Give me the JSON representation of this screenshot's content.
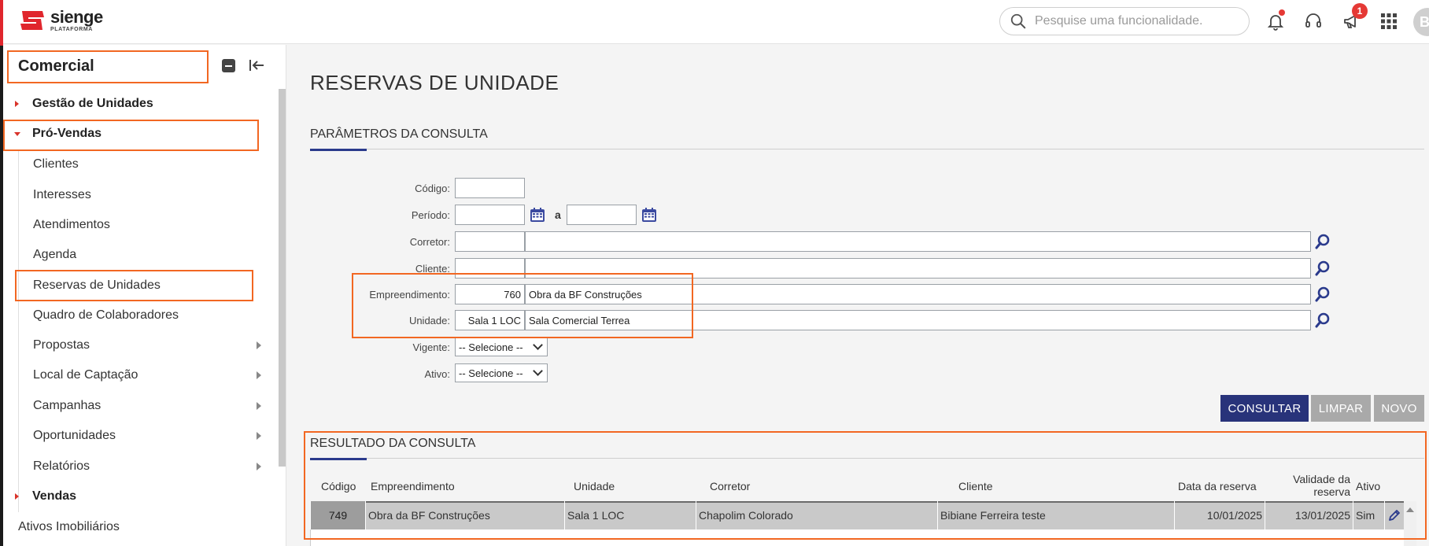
{
  "brand": {
    "name": "sienge",
    "sub": "PLATAFORMA",
    "accent": "#e0262d"
  },
  "header": {
    "search_placeholder": "Pesquise uma funcionalidade.",
    "announcement_count": "1",
    "avatar_initial": "B"
  },
  "sidebar": {
    "title": "Comercial",
    "items": [
      {
        "label": "Gestão de Unidades"
      },
      {
        "label": "Pró-Vendas"
      },
      {
        "label": "Clientes"
      },
      {
        "label": "Interesses"
      },
      {
        "label": "Atendimentos"
      },
      {
        "label": "Agenda"
      },
      {
        "label": "Reservas de Unidades"
      },
      {
        "label": "Quadro de Colaboradores"
      },
      {
        "label": "Propostas"
      },
      {
        "label": "Local de Captação"
      },
      {
        "label": "Campanhas"
      },
      {
        "label": "Oportunidades"
      },
      {
        "label": "Relatórios"
      },
      {
        "label": "Vendas"
      },
      {
        "label": "Ativos Imobiliários"
      }
    ]
  },
  "main": {
    "title": "RESERVAS DE UNIDADE",
    "params_title": "PARÂMETROS DA CONSULTA",
    "fields": {
      "codigo": {
        "label": "Código",
        "value": ""
      },
      "periodo": {
        "label": "Período",
        "from": "",
        "sep": "a",
        "to": ""
      },
      "corretor": {
        "label": "Corretor",
        "code": "",
        "name": ""
      },
      "cliente": {
        "label": "Cliente",
        "code": "",
        "name": ""
      },
      "empreendimento": {
        "label": "Empreendimento",
        "code": "760",
        "name": "Obra da BF Construções"
      },
      "unidade": {
        "label": "Unidade",
        "code": "Sala 1 LOC",
        "name": "Sala Comercial Terrea"
      },
      "vigente": {
        "label": "Vigente",
        "value": "-- Selecione --"
      },
      "ativo": {
        "label": "Ativo",
        "value": "-- Selecione --"
      }
    },
    "buttons": {
      "consultar": "CONSULTAR",
      "limpar": "LIMPAR",
      "novo": "NOVO"
    },
    "results_title": "RESULTADO DA CONSULTA",
    "table": {
      "columns": [
        "Código",
        "Empreendimento",
        "Unidade",
        "Corretor",
        "Cliente",
        "Data da reserva",
        "Validade da",
        "reserva",
        "Ativo"
      ],
      "rows": [
        {
          "codigo": "749",
          "empreendimento": "Obra da BF Construções",
          "unidade": "Sala 1 LOC",
          "corretor": "Chapolim Colorado",
          "cliente": "Bibiane Ferreira teste",
          "data": "10/01/2025",
          "validade": "13/01/2025",
          "ativo": "Sim"
        }
      ]
    }
  },
  "colors": {
    "primary_button": "#28337a",
    "highlight": "#f26722",
    "section_accent": "#2a3a8c"
  }
}
